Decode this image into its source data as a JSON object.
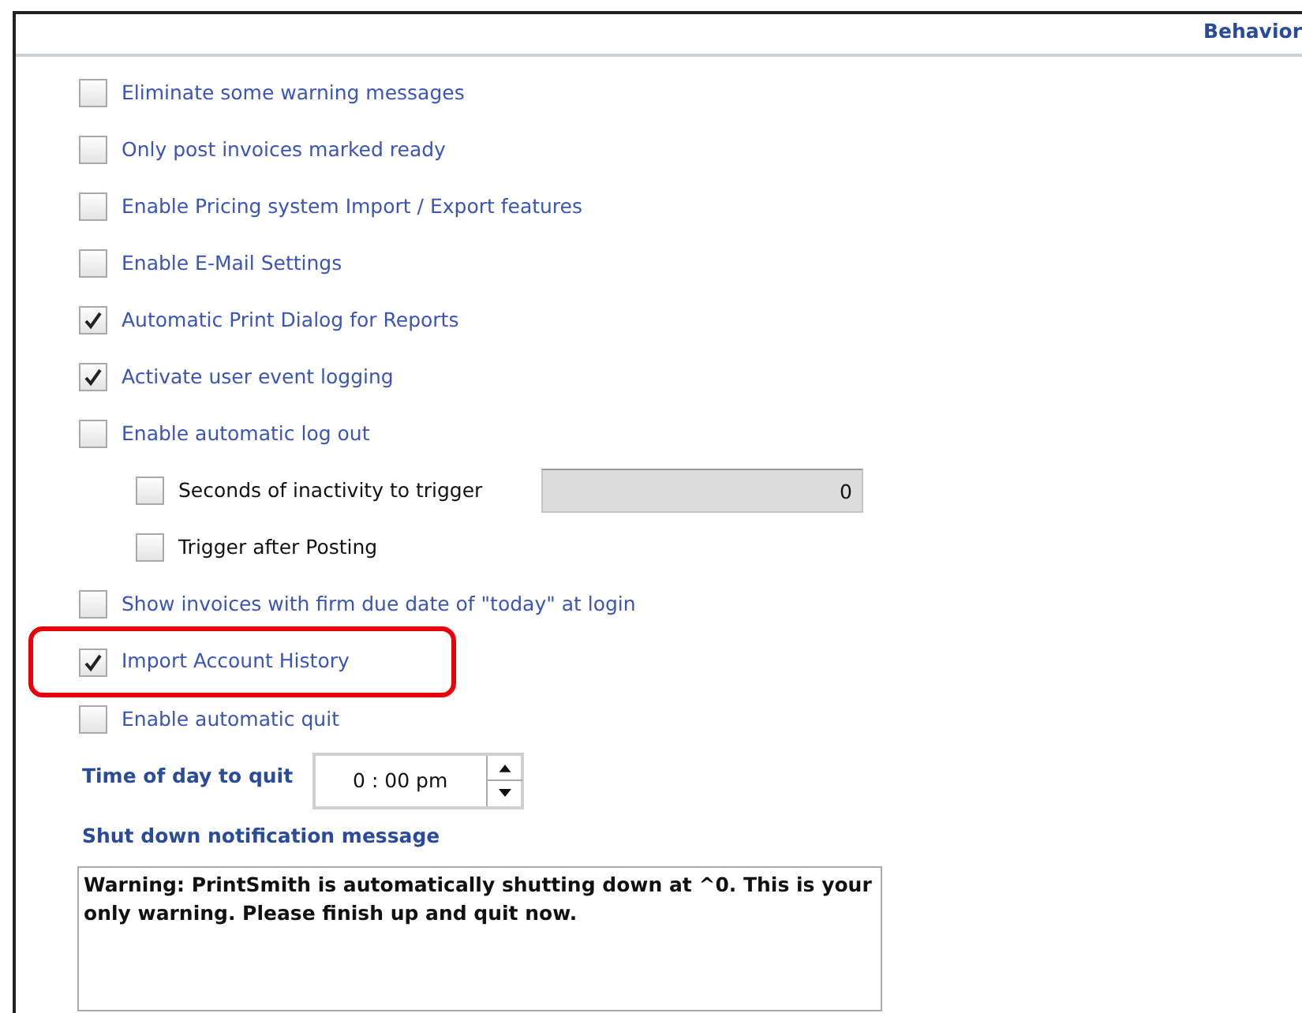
{
  "header": {
    "title": "Behavior"
  },
  "options": [
    {
      "label": "Eliminate some warning messages",
      "checked": false,
      "highlighted": false
    },
    {
      "label": "Only post invoices marked ready",
      "checked": false,
      "highlighted": false
    },
    {
      "label": "Enable Pricing system Import / Export features",
      "checked": false,
      "highlighted": false
    },
    {
      "label": "Enable E-Mail Settings",
      "checked": false,
      "highlighted": false
    },
    {
      "label": "Automatic Print Dialog for Reports",
      "checked": true,
      "highlighted": false
    },
    {
      "label": "Activate user event logging",
      "checked": true,
      "highlighted": false
    },
    {
      "label": "Enable automatic log out",
      "checked": false,
      "highlighted": false,
      "children": [
        {
          "label": "Seconds of inactivity to trigger",
          "checked": false,
          "value": "0"
        },
        {
          "label": "Trigger after Posting",
          "checked": false
        }
      ]
    },
    {
      "label": "Show invoices with firm due date of \"today\" at login",
      "checked": false,
      "highlighted": false
    },
    {
      "label": "Import Account History",
      "checked": true,
      "highlighted": true
    },
    {
      "label": "Enable automatic quit",
      "checked": false,
      "highlighted": false
    }
  ],
  "quit_time": {
    "label": "Time of day to quit",
    "value": "0 : 00 pm"
  },
  "notification": {
    "label": "Shut down notification message",
    "value": "Warning: PrintSmith is automatically shutting down at ^0. This is your only warning. Please finish up and quit now."
  }
}
